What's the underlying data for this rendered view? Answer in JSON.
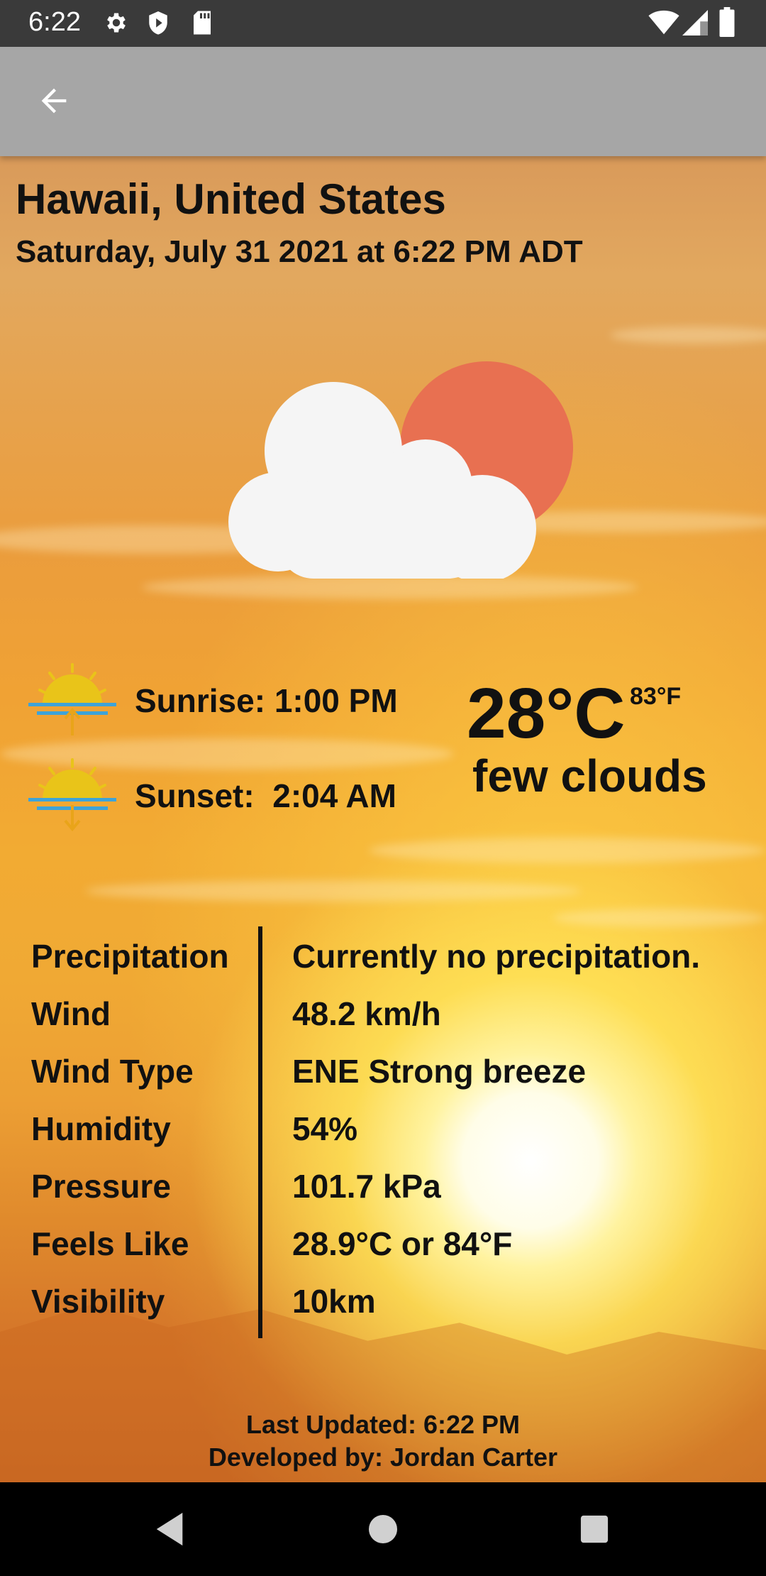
{
  "status_bar": {
    "time": "6:22",
    "icons": [
      "gear-icon",
      "shield-icon",
      "sd-card-icon",
      "wifi-icon",
      "signal-icon",
      "battery-icon"
    ]
  },
  "app_bar": {
    "back_icon": "arrow-left-icon"
  },
  "location": {
    "name": "Hawaii, United States",
    "datetime": "Saturday, July 31 2021 at 6:22 PM ADT"
  },
  "weather": {
    "icon": "partly-cloudy-icon",
    "sunrise": "Sunrise: 1:00 PM",
    "sunset": "Sunset:  2:04 AM",
    "temp_c": "28°C",
    "temp_f": "83°F",
    "condition": "few clouds"
  },
  "details": [
    {
      "label": "Precipitation",
      "value": "Currently no precipitation."
    },
    {
      "label": "Wind",
      "value": "48.2 km/h"
    },
    {
      "label": "Wind Type",
      "value": "ENE Strong breeze"
    },
    {
      "label": "Humidity",
      "value": "54%"
    },
    {
      "label": "Pressure",
      "value": "101.7 kPa"
    },
    {
      "label": "Feels Like",
      "value": "28.9°C or 84°F"
    },
    {
      "label": "Visibility",
      "value": "10km"
    }
  ],
  "footer": {
    "last_updated": "Last Updated: 6:22 PM",
    "developer": "Developed by: Jordan Carter"
  },
  "colors": {
    "status_bar": "#3a3a3a",
    "app_bar": "#a6a6a6",
    "text": "#111111",
    "sun": "#e9c419",
    "horizon_line": "#3ea3d8",
    "arrow": "#e9a419",
    "cloud": "#f5f5f5",
    "cloud_sun": "#e87051"
  }
}
